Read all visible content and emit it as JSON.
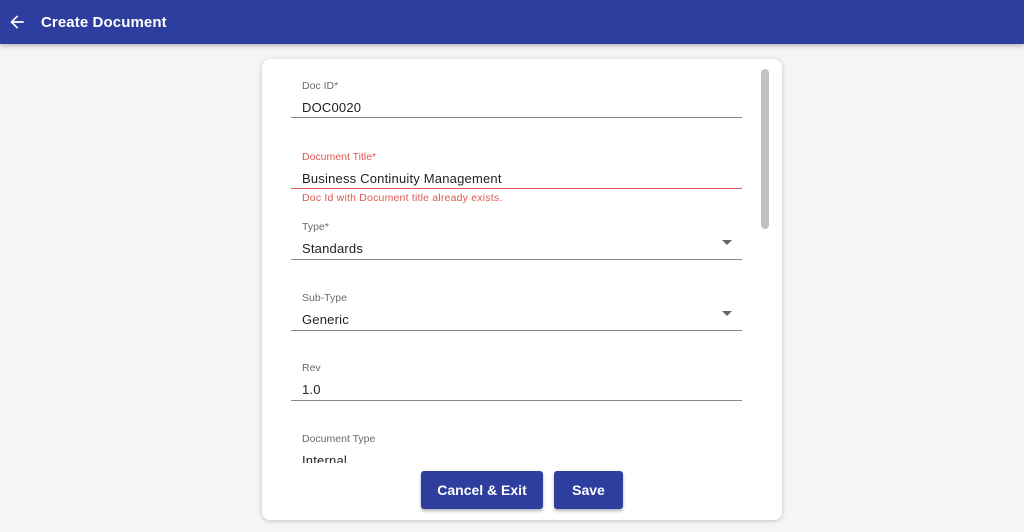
{
  "header": {
    "title": "Create Document",
    "back_icon": "arrow-left-icon"
  },
  "form": {
    "doc_id": {
      "label": "Doc ID*",
      "value": "DOC0020"
    },
    "document_title": {
      "label": "Document Title*",
      "value": "Business Continuity Management",
      "error": "Doc Id with Document title already exists."
    },
    "type": {
      "label": "Type*",
      "value": "Standards"
    },
    "sub_type": {
      "label": "Sub-Type",
      "value": "Generic"
    },
    "rev": {
      "label": "Rev",
      "value": "1.0"
    },
    "document_type": {
      "label": "Document Type",
      "value": "Internal"
    }
  },
  "actions": {
    "cancel_label": "Cancel & Exit",
    "save_label": "Save"
  },
  "colors": {
    "primary": "#2e3e9e",
    "error": "#e0584f",
    "background": "#f5f5f5"
  }
}
